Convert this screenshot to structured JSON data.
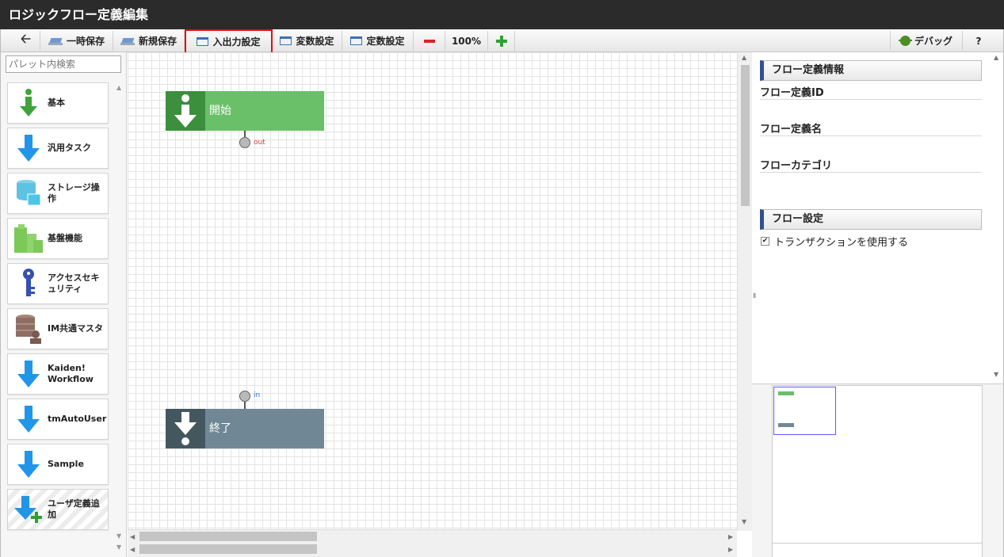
{
  "window": {
    "title": "ロジックフロー定義編集"
  },
  "toolbar": {
    "temp_save": "一時保存",
    "new_save": "新規保存",
    "io_settings": "入出力設定",
    "var_settings": "変数設定",
    "const_settings": "定数設定",
    "zoom": "100%",
    "debug": "デバッグ",
    "help": "?"
  },
  "palette": {
    "search_placeholder": "パレット内検索",
    "items": [
      {
        "label": "基本",
        "icon": "green-down-arrow-icon"
      },
      {
        "label": "汎用タスク",
        "icon": "blue-down-arrow-icon"
      },
      {
        "label": "ストレージ操作",
        "icon": "storage-icon"
      },
      {
        "label": "基盤機能",
        "icon": "grid-blocks-icon"
      },
      {
        "label": "アクセスセキュリティ",
        "icon": "key-icon"
      },
      {
        "label": "IM共通マスタ",
        "icon": "database-user-icon"
      },
      {
        "label": "Kaiden! Workflow",
        "icon": "blue-down-arrow-icon"
      },
      {
        "label": "tmAutoUser",
        "icon": "blue-down-arrow-icon"
      },
      {
        "label": "Sample",
        "icon": "blue-down-arrow-icon"
      },
      {
        "label": "ユーザ定義追加",
        "icon": "add-user-definition-icon"
      }
    ]
  },
  "canvas": {
    "start_node": {
      "label": "開始",
      "port": "out",
      "color": "#6abf69",
      "icon_color": "#3b8f3d"
    },
    "end_node": {
      "label": "終了",
      "port": "in",
      "color": "#708896",
      "icon_color": "#44575f"
    }
  },
  "properties": {
    "flow_info_header": "フロー定義情報",
    "flow_id_label": "フロー定義ID",
    "flow_name_label": "フロー定義名",
    "flow_category_label": "フローカテゴリ",
    "flow_settings_header": "フロー設定",
    "transaction_label": "トランザクションを使用する",
    "transaction_checked": true
  },
  "colors": {
    "titlebar": "#2b2b2b",
    "accent": "#33508f",
    "highlight": "#e01010"
  }
}
